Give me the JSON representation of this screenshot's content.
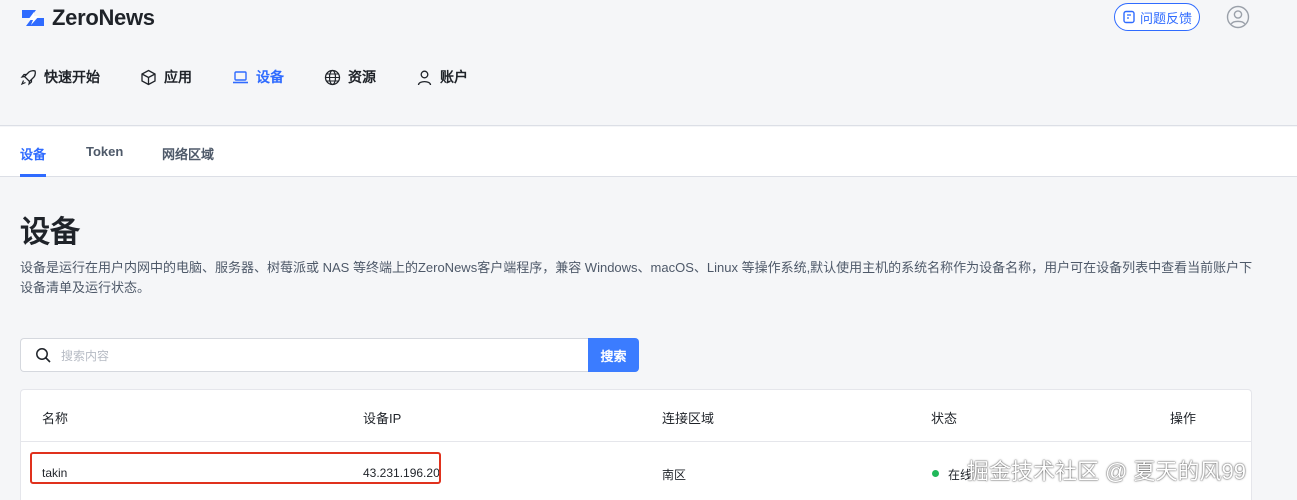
{
  "app": {
    "logo_text": "ZeroNews"
  },
  "header": {
    "feedback_label": "问题反馈",
    "nav": [
      {
        "label": "快速开始",
        "icon": "rocket-icon",
        "active": false
      },
      {
        "label": "应用",
        "icon": "cube-icon",
        "active": false
      },
      {
        "label": "设备",
        "icon": "laptop-icon",
        "active": true
      },
      {
        "label": "资源",
        "icon": "globe-icon",
        "active": false
      },
      {
        "label": "账户",
        "icon": "user-icon",
        "active": false
      }
    ]
  },
  "subtabs": [
    {
      "label": "设备",
      "active": true
    },
    {
      "label": "Token",
      "active": false
    },
    {
      "label": "网络区域",
      "active": false
    }
  ],
  "page": {
    "title": "设备",
    "description": "设备是运行在用户内网中的电脑、服务器、树莓派或 NAS 等终端上的ZeroNews客户端程序，兼容 Windows、macOS、Linux 等操作系统,默认使用主机的系统名称作为设备名称，用户可在设备列表中查看当前账户下设备清单及运行状态。"
  },
  "search": {
    "placeholder": "搜索内容",
    "value": "",
    "button_label": "搜索"
  },
  "table": {
    "columns": [
      "名称",
      "设备IP",
      "连接区域",
      "状态",
      "操作"
    ],
    "rows": [
      {
        "name": "takin",
        "ip": "43.231.196.20",
        "region": "南区",
        "status": "在线"
      }
    ]
  },
  "watermark": "掘金技术社区 @ 夏天的风99",
  "colors": {
    "accent": "#2f6bff",
    "highlight": "#e0311d",
    "online": "#20b85a"
  }
}
